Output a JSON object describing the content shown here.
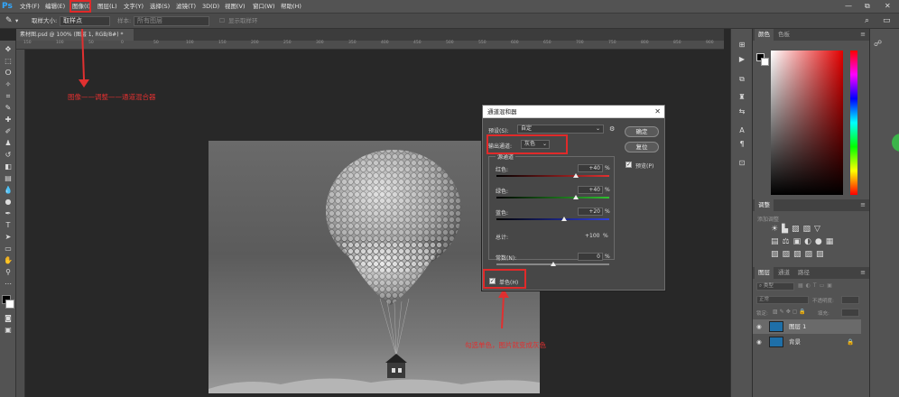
{
  "app": {
    "logo": "Ps"
  },
  "menubar": {
    "items": [
      "文件(F)",
      "编辑(E)",
      "图像(I)",
      "图层(L)",
      "文字(Y)",
      "选择(S)",
      "滤镜(T)",
      "3D(D)",
      "视图(V)",
      "窗口(W)",
      "帮助(H)"
    ],
    "window_controls": [
      "—",
      "⧉",
      "✕"
    ]
  },
  "options": {
    "sample_size_label": "取样大小:",
    "sample_size_value": "取样点",
    "sample_label": "样本:",
    "sample_value": "所有图层",
    "show_ring": "显示取样环"
  },
  "document": {
    "tab_title": "素材图.psd @ 100% (图层 1, RGB/8#) *"
  },
  "ruler": {
    "ticks": [
      "150",
      "100",
      "50",
      "0",
      "50",
      "100",
      "150",
      "200",
      "250",
      "300",
      "350",
      "400",
      "450",
      "500",
      "550",
      "600",
      "650",
      "700",
      "750",
      "800",
      "850",
      "900"
    ]
  },
  "annotations": {
    "menu_path": "图像——调整——通道混合器",
    "monochrome_hint": "勾选单色，图片就变成灰色"
  },
  "dialog": {
    "title": "通道混和器",
    "preset_label": "预设(S):",
    "preset_value": "自定",
    "output_label": "输出通道:",
    "output_value": "灰色",
    "source_group": "源通道",
    "red_label": "红色:",
    "red_value": "+40",
    "green_label": "绿色:",
    "green_value": "+40",
    "blue_label": "蓝色:",
    "blue_value": "+20",
    "total_label": "总计:",
    "total_value": "+100",
    "constant_label": "常数(N):",
    "constant_value": "0",
    "percent": "%",
    "monochrome_label": "单色(H)",
    "ok_label": "确定",
    "reset_label": "复位",
    "preview_label": "预览(P)",
    "levels": {
      "red": 0.7,
      "green": 0.7,
      "blue": 0.6,
      "constant": 0.5
    }
  },
  "panels": {
    "color_tabs": [
      "颜色",
      "色板"
    ],
    "adjust_tab": "调整",
    "adjust_hint": "添加调整",
    "layers_tabs": [
      "图层",
      "通道",
      "路径"
    ],
    "kind_label": "类型",
    "blend_mode": "正常",
    "opacity_label": "不透明度:",
    "lock_label": "锁定:",
    "fill_label": "填充:",
    "layers": [
      {
        "name": "图层 1"
      },
      {
        "name": "背景"
      }
    ]
  },
  "colors": {
    "accent": "#31a8ff",
    "annotation": "#e03030",
    "highlight_box": "#e02a2a"
  }
}
